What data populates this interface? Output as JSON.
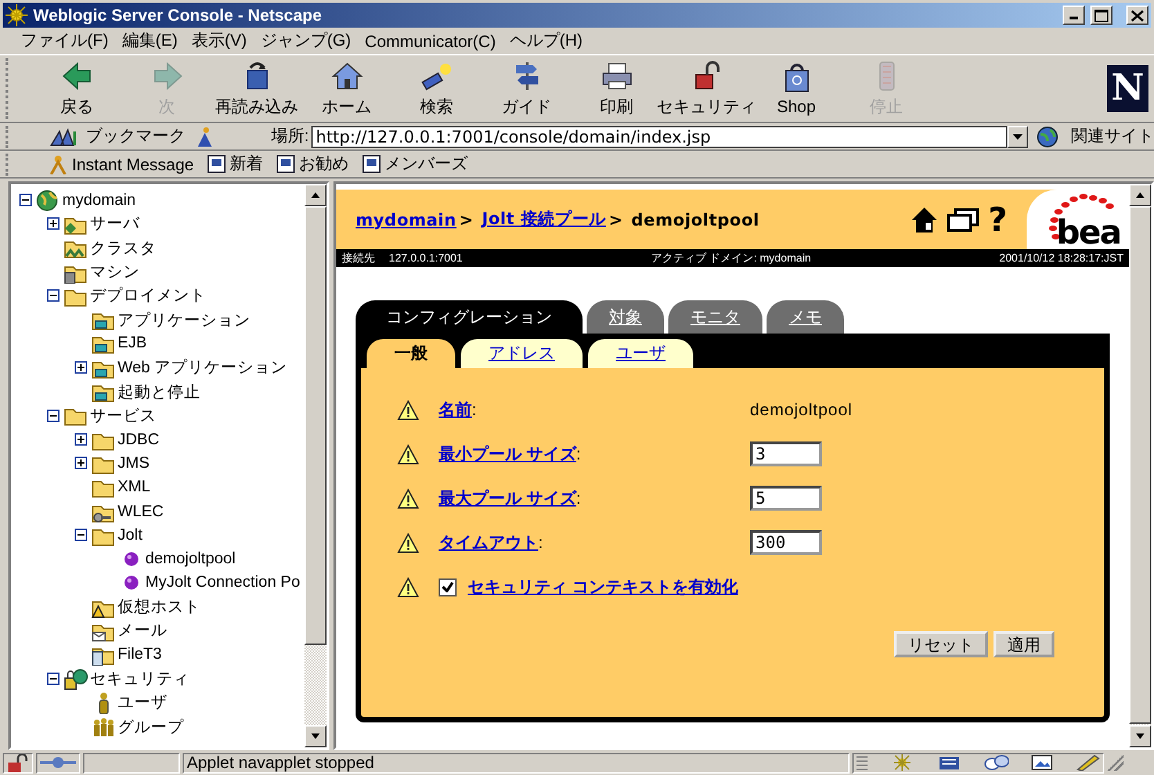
{
  "window": {
    "title": "Weblogic Server Console - Netscape"
  },
  "menu": [
    "ファイル(F)",
    "編集(E)",
    "表示(V)",
    "ジャンプ(G)",
    "Communicator(C)",
    "ヘルプ(H)"
  ],
  "toolbar": [
    {
      "label": "戻る",
      "disabled": false
    },
    {
      "label": "次",
      "disabled": true
    },
    {
      "label": "再読み込み",
      "disabled": false
    },
    {
      "label": "ホーム",
      "disabled": false
    },
    {
      "label": "検索",
      "disabled": false
    },
    {
      "label": "ガイド",
      "disabled": false
    },
    {
      "label": "印刷",
      "disabled": false
    },
    {
      "label": "セキュリティ",
      "disabled": false
    },
    {
      "label": "Shop",
      "disabled": false
    },
    {
      "label": "停止",
      "disabled": true
    }
  ],
  "brand_mark": "N",
  "location_bar": {
    "bookmarks": "ブックマーク",
    "location_label": "場所:",
    "url": "http://127.0.0.1:7001/console/domain/index.jsp",
    "related": "関連サイト"
  },
  "personal_toolbar": [
    "Instant Message",
    "新着",
    "お勧め",
    "メンバーズ"
  ],
  "tree": [
    {
      "label": "mydomain",
      "kind": "domain",
      "expanded": true,
      "children": [
        {
          "label": "サーバ",
          "kind": "server",
          "expanded": false
        },
        {
          "label": "クラスタ",
          "kind": "cluster"
        },
        {
          "label": "マシン",
          "kind": "machine"
        },
        {
          "label": "デプロイメント",
          "kind": "folder",
          "expanded": true,
          "children": [
            {
              "label": "アプリケーション",
              "kind": "component"
            },
            {
              "label": "EJB",
              "kind": "component"
            },
            {
              "label": "Web アプリケーション",
              "kind": "component",
              "expanded": false
            },
            {
              "label": "起動と停止",
              "kind": "component"
            }
          ]
        },
        {
          "label": "サービス",
          "kind": "folder",
          "expanded": true,
          "children": [
            {
              "label": "JDBC",
              "kind": "folder",
              "expanded": false
            },
            {
              "label": "JMS",
              "kind": "folder",
              "expanded": false
            },
            {
              "label": "XML",
              "kind": "folder"
            },
            {
              "label": "WLEC",
              "kind": "wlec"
            },
            {
              "label": "Jolt",
              "kind": "folder",
              "expanded": true,
              "children": [
                {
                  "label": "demojoltpool",
                  "kind": "pool"
                },
                {
                  "label": "MyJolt Connection Po",
                  "kind": "pool"
                }
              ]
            },
            {
              "label": "仮想ホスト",
              "kind": "virtual-host"
            },
            {
              "label": "メール",
              "kind": "mail"
            },
            {
              "label": "FileT3",
              "kind": "file"
            }
          ]
        },
        {
          "label": "セキュリティ",
          "kind": "security",
          "expanded": true,
          "children": [
            {
              "label": "ユーザ",
              "kind": "user"
            },
            {
              "label": "グループ",
              "kind": "group"
            }
          ]
        }
      ]
    }
  ],
  "console": {
    "breadcrumb": [
      {
        "text": "mydomain",
        "kind": "link"
      },
      {
        "text": ">",
        "kind": "separator"
      },
      {
        "text": "Jolt 接続プール",
        "kind": "link"
      },
      {
        "text": ">",
        "kind": "separator"
      },
      {
        "text": "demojoltpool",
        "kind": "current"
      }
    ],
    "help": "?",
    "logo": "bea",
    "info_bar": {
      "server_label": "接続先",
      "server": "127.0.0.1:7001",
      "domain": "アクティブ ドメイン: mydomain",
      "timestamp": "2001/10/12 18:28:17:JST"
    },
    "tabs": [
      {
        "label": "コンフィグレーション",
        "selected": true
      },
      {
        "label": "対象",
        "selected": false
      },
      {
        "label": "モニタ",
        "selected": false
      },
      {
        "label": "メモ",
        "selected": false
      }
    ],
    "subtabs": [
      {
        "label": "一般",
        "selected": true
      },
      {
        "label": "アドレス",
        "selected": false
      },
      {
        "label": "ユーザ",
        "selected": false
      }
    ],
    "fields": [
      {
        "kind": "text",
        "label": "名前",
        "suffix": ":",
        "value": "demojoltpool"
      },
      {
        "kind": "input",
        "label": "最小プール サイズ",
        "suffix": ":",
        "value": "3"
      },
      {
        "kind": "input",
        "label": "最大プール サイズ",
        "suffix": ":",
        "value": "5"
      },
      {
        "kind": "input",
        "label": "タイムアウト",
        "suffix": ":",
        "value": "300"
      },
      {
        "kind": "checkbox",
        "label": "セキュリティ コンテキストを有効化",
        "checked": true
      }
    ],
    "buttons": [
      "リセット",
      "適用"
    ]
  },
  "status_bar": {
    "message": "Applet navapplet stopped"
  }
}
